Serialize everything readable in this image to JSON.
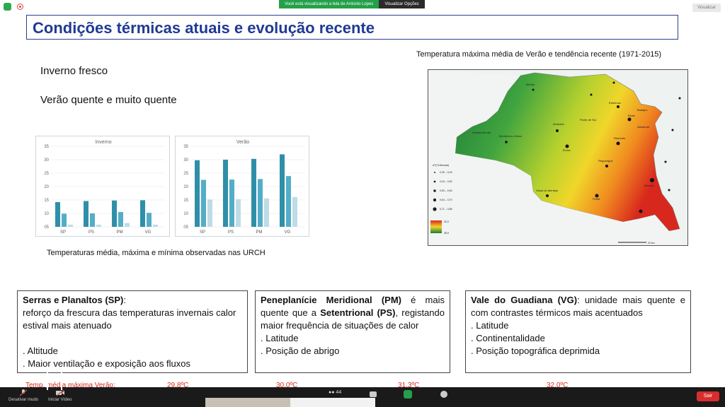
{
  "zoom": {
    "share_banner": "Você está visualizando a tela de Antonio Lopes",
    "view_options": "Visualizar Opções",
    "view_button": "Visualizar",
    "toolbar": {
      "mute": "Desativar mudo",
      "video": "Iniciar Vídeo",
      "participants_count": "44",
      "leave": "Sair"
    }
  },
  "slide": {
    "title": "Condições térmicas atuais e evolução recente",
    "bullets": [
      "Inverno fresco",
      "Verão quente e muito quente"
    ],
    "chart_caption": "Temperaturas média, máxima e mínima observadas nas URCH",
    "map_title": "Temperatura máxima média de Verão e tendência recente (1971-2015)",
    "map_labels": [
      "Mérida",
      "Badajoz",
      "Estremoz",
      "Elvas",
      "Arraiolos",
      "Ponte de Sor",
      "Montemor-o-Novo",
      "Évora",
      "Alandroal",
      "Redondo",
      "Reguengos",
      "Mourão",
      "Viana do Alentejo",
      "Portel",
      "Vendas Novas"
    ],
    "legend_title": "ΔT(ºC/década)",
    "legend_items": [
      "0,39 – 0,43",
      "0,44 – 0,52",
      "0,53 – 0,63",
      "0,64 – 0,70",
      "0,71 – 0,86"
    ],
    "color_scale": [
      "32,0",
      "28,9"
    ],
    "scale_label": "20 km",
    "boxes": [
      {
        "lead": "Serras e Planaltos (SP)",
        "lead_suffix": ":",
        "lines": [
          "reforço da frescura das temperaturas invernais calor estival mais atenuado",
          "",
          ". Altitude",
          ". Maior ventilação e exposição aos fluxos"
        ]
      },
      {
        "lead": "Peneplanície Meridional (PM)",
        "text": " é mais quente que a ",
        "bold2": "Setentrional (PS)",
        "rest": ", registando maior frequência de situações de calor",
        "lines": [
          ". Latitude",
          ". Posição de abrigo"
        ]
      },
      {
        "lead": "Vale do Guadiana (VG)",
        "text": ": unidade mais quente e com contrastes térmicos mais acentuados",
        "lines": [
          ". Latitude",
          ". Continentalidade",
          ". Posição topográfica deprimida"
        ]
      }
    ],
    "temp_row": {
      "label": "Temp. média máxima Verão:",
      "values": [
        "29,8ºC",
        "30,0ºC",
        "31,3ºC",
        "32,0ºC"
      ]
    }
  },
  "chart_data": [
    {
      "type": "bar",
      "title": "Inverno",
      "categories": [
        "SP",
        "PS",
        "PM",
        "VG"
      ],
      "series": [
        {
          "values": [
            14.2,
            14.6,
            14.8,
            14.9
          ]
        },
        {
          "values": [
            9.9,
            10.0,
            10.5,
            10.2
          ]
        },
        {
          "values": [
            5.8,
            5.8,
            6.4,
            5.8
          ]
        }
      ],
      "yticks": [
        "05",
        "10",
        "15",
        "20",
        "25",
        "30",
        "35"
      ],
      "ylim": [
        5,
        35
      ],
      "colors": [
        "#2f8fa8",
        "#52aec8",
        "#bfdbe6"
      ]
    },
    {
      "type": "bar",
      "title": "Verão",
      "categories": [
        "SP",
        "PS",
        "PM",
        "VG"
      ],
      "series": [
        {
          "values": [
            29.8,
            30.0,
            30.3,
            32.0
          ]
        },
        {
          "values": [
            22.5,
            22.6,
            22.8,
            23.9
          ]
        },
        {
          "values": [
            15.2,
            15.3,
            15.6,
            16.1
          ]
        }
      ],
      "yticks": [
        "05",
        "10",
        "15",
        "20",
        "25",
        "30",
        "35"
      ],
      "ylim": [
        5,
        35
      ],
      "colors": [
        "#2f8fa8",
        "#52aec8",
        "#bfdbe6"
      ]
    }
  ]
}
